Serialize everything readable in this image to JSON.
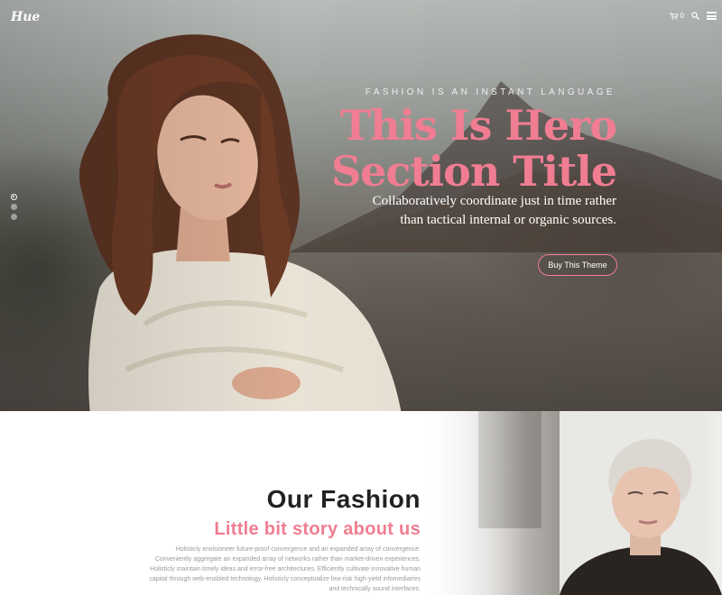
{
  "header": {
    "logo": "Hue",
    "cart_count": "0"
  },
  "hero": {
    "tagline": "FASHION IS AN INSTANT LANGUAGE",
    "title_line1": "This Is Hero",
    "title_line2": "Section Title",
    "subtitle_line1": "Collaboratively coordinate just in time rather",
    "subtitle_line2": "than tactical internal or organic sources.",
    "button_label": "Buy This Theme",
    "slides": 3,
    "active_slide": 1
  },
  "about": {
    "title": "Our Fashion",
    "subtitle": "Little bit story about us",
    "body_lines": [
      "Holisticly envisioneer future-proof convergence and an expanded array of convergence.",
      "Conveniently aggregate an expanded array of networks rather than market-driven experiences.",
      "Holisticly maintain timely ideas and error-free architectures. Efficiently cultivate innovative human",
      "capital through web-enabled technology. Holisticly conceptualize low-risk high-yield infomediaries",
      "and technically sound interfaces."
    ]
  },
  "colors": {
    "accent": "#f07d91",
    "heading": "#222222",
    "body_text": "#9a9a9a"
  },
  "icons": {
    "cart": "cart-icon",
    "search": "search-icon",
    "menu": "hamburger-menu-icon"
  }
}
